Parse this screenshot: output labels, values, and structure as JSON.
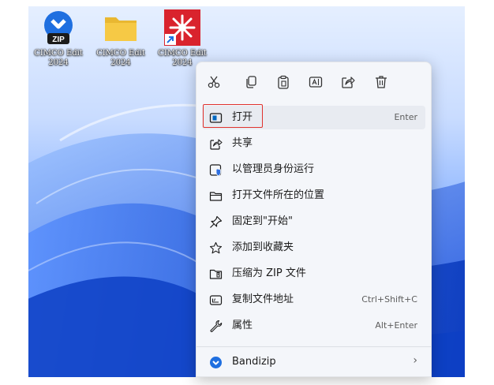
{
  "desktop": {
    "icons": [
      {
        "label": "CIMCO Edit\n2024",
        "badge": "ZIP",
        "icon": "bandizip-zip-icon"
      },
      {
        "label": "CIMCO Edit\n2024",
        "icon": "folder-icon"
      },
      {
        "label": "CIMCO Edit\n2024",
        "icon": "cimco-edit-shortcut-icon"
      }
    ]
  },
  "menu": {
    "toolbar": [
      {
        "name": "cut-icon"
      },
      {
        "name": "copy-icon"
      },
      {
        "name": "paste-icon"
      },
      {
        "name": "rename-icon"
      },
      {
        "name": "share-icon"
      },
      {
        "name": "delete-icon"
      }
    ],
    "items": [
      {
        "label": "打开",
        "shortcut": "Enter",
        "icon": "open-icon",
        "selected": true
      },
      {
        "label": "共享",
        "shortcut": "",
        "icon": "share-icon"
      },
      {
        "label": "以管理员身份运行",
        "shortcut": "",
        "icon": "shield-icon"
      },
      {
        "label": "打开文件所在的位置",
        "shortcut": "",
        "icon": "folder-outline-icon"
      },
      {
        "label": "固定到\"开始\"",
        "shortcut": "",
        "icon": "pin-icon"
      },
      {
        "label": "添加到收藏夹",
        "shortcut": "",
        "icon": "star-icon"
      },
      {
        "label": "压缩为 ZIP 文件",
        "shortcut": "",
        "icon": "zip-archive-icon"
      },
      {
        "label": "复制文件地址",
        "shortcut": "Ctrl+Shift+C",
        "icon": "copy-path-icon"
      },
      {
        "label": "属性",
        "shortcut": "Alt+Enter",
        "icon": "wrench-icon"
      },
      {
        "label": "Bandizip",
        "shortcut": "›",
        "icon": "bandizip-icon"
      }
    ]
  },
  "colors": {
    "accent": "#0067c0",
    "highlight": "#e0322d",
    "cimco_red": "#d9232d",
    "folder_yellow": "#f6c945"
  }
}
